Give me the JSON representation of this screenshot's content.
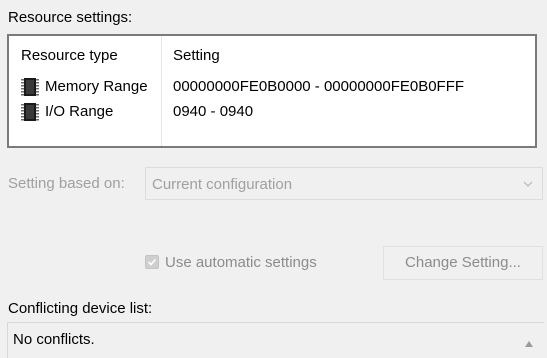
{
  "resource_settings": {
    "label": "Resource settings:",
    "columns": {
      "type": "Resource type",
      "setting": "Setting"
    },
    "rows": [
      {
        "type": "Memory Range",
        "setting": "00000000FE0B0000 - 00000000FE0B0FFF",
        "icon": "memory-chip-icon"
      },
      {
        "type": "I/O Range",
        "setting": "0940 - 0940",
        "icon": "memory-chip-icon"
      }
    ]
  },
  "setting_based_on": {
    "label": "Setting based on:",
    "value": "Current configuration",
    "enabled": false
  },
  "auto_settings": {
    "label": "Use automatic settings",
    "checked": true,
    "enabled": false
  },
  "change_setting": {
    "label": "Change Setting...",
    "enabled": false
  },
  "conflicts": {
    "label": "Conflicting device list:",
    "text": "No conflicts."
  },
  "colors": {
    "background": "#f0f0f0",
    "list_border": "#7a7a7a",
    "disabled_text": "#a0a0a0"
  }
}
